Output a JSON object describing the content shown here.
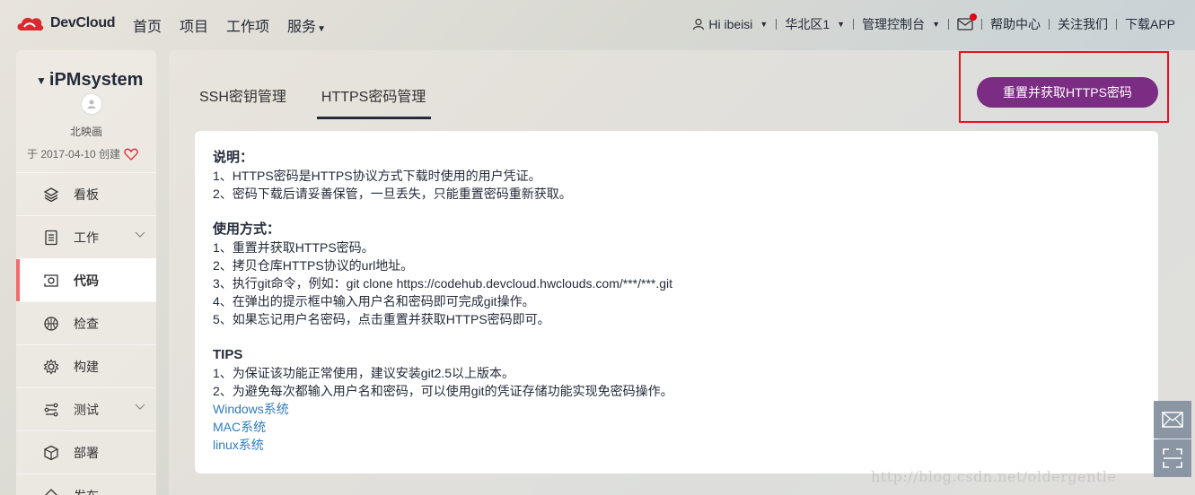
{
  "header": {
    "logo_text": "DevCloud",
    "nav": [
      "首页",
      "项目",
      "工作项",
      "服务"
    ],
    "user": "Hi ibeisi",
    "region": "华北区1",
    "console": "管理控制台",
    "help": "帮助中心",
    "follow": "关注我们",
    "download": "下载APP"
  },
  "sidebar": {
    "project_name": "iPMsystem",
    "owner": "北映画",
    "created": "于 2017-04-10 创建",
    "items": [
      {
        "label": "看板",
        "icon": "layers-icon"
      },
      {
        "label": "工作",
        "icon": "list-icon"
      },
      {
        "label": "代码",
        "icon": "code-icon"
      },
      {
        "label": "检查",
        "icon": "inspect-icon"
      },
      {
        "label": "构建",
        "icon": "build-icon"
      },
      {
        "label": "测试",
        "icon": "test-icon"
      },
      {
        "label": "部署",
        "icon": "deploy-icon"
      },
      {
        "label": "发布",
        "icon": "release-icon"
      }
    ]
  },
  "tabs": [
    "SSH密钥管理",
    "HTTPS密码管理"
  ],
  "reset_button": "重置并获取HTTPS密码",
  "content": {
    "intro_title": "说明：",
    "intro": [
      "1、HTTPS密码是HTTPS协议方式下载时使用的用户凭证。",
      "2、密码下载后请妥善保管，一旦丢失，只能重置密码重新获取。"
    ],
    "usage_title": "使用方式：",
    "usage": [
      "1、重置并获取HTTPS密码。",
      "2、拷贝仓库HTTPS协议的url地址。",
      "3、执行git命令，例如：git clone https://codehub.devcloud.hwclouds.com/***/***.git",
      "4、在弹出的提示框中输入用户名和密码即可完成git操作。",
      "5、如果忘记用户名密码，点击重置并获取HTTPS密码即可。"
    ],
    "tips_title": "TIPS",
    "tips": [
      "1、为保证该功能正常使用，建议安装git2.5以上版本。",
      "2、为避免每次都输入用户名和密码，可以使用git的凭证存储功能实现免密码操作。"
    ],
    "links": [
      "Windows系统",
      "MAC系统",
      "linux系统"
    ]
  },
  "watermark": "http://blog.csdn.net/oldergentle",
  "colors": {
    "accent": "#7b2c83",
    "link": "#2f7bbf",
    "highlight": "#e8131e",
    "active_marker": "#f26c6c"
  }
}
